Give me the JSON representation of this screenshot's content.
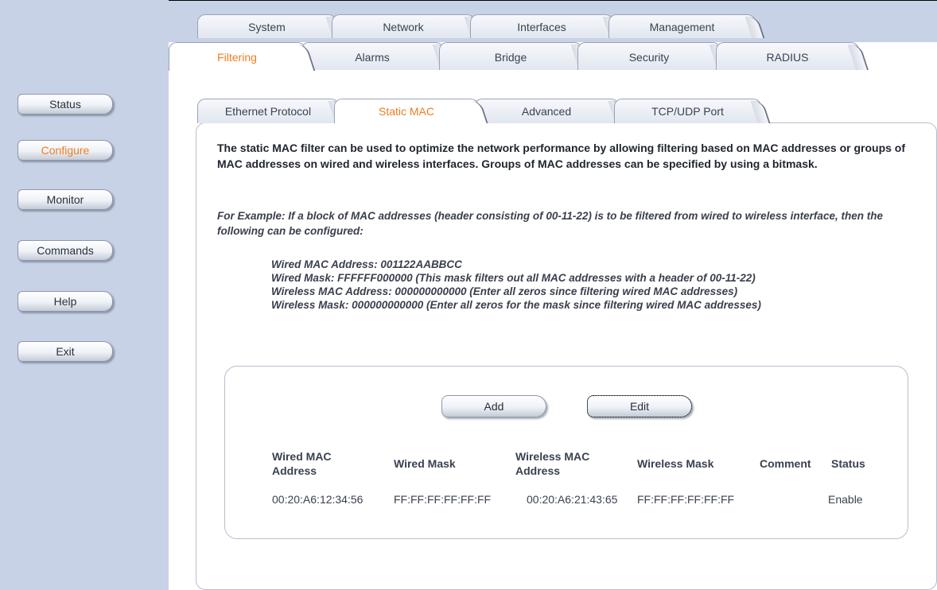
{
  "nav": {
    "items": [
      {
        "label": "Status",
        "active": false
      },
      {
        "label": "Configure",
        "active": true
      },
      {
        "label": "Monitor",
        "active": false
      },
      {
        "label": "Commands",
        "active": false
      },
      {
        "label": "Help",
        "active": false
      },
      {
        "label": "Exit",
        "active": false
      }
    ]
  },
  "tabs_row1": [
    "System",
    "Network",
    "Interfaces",
    "Management"
  ],
  "tabs_row2": [
    "Filtering",
    "Alarms",
    "Bridge",
    "Security",
    "RADIUS"
  ],
  "tabs_row3": [
    "Ethernet Protocol",
    "Static MAC",
    "Advanced",
    "TCP/UDP Port"
  ],
  "active": {
    "row2": "Filtering",
    "row3": "Static MAC"
  },
  "content": {
    "description": "The static MAC filter can be used to optimize the network performance by allowing filtering based on MAC addresses or groups of MAC addresses on wired and wireless interfaces. Groups of MAC addresses can be specified by using a bitmask.",
    "example_intro": "For Example: If a block of MAC addresses (header consisting of 00-11-22) is to be filtered from wired to wireless interface, then the following can be configured:",
    "example_lines": [
      "Wired MAC Address: 001122AABBCC",
      "Wired Mask: FFFFFF000000 (This mask filters out all MAC addresses with a header of 00-11-22)",
      "Wireless MAC Address: 000000000000 (Enter all zeros since filtering wired MAC addresses)",
      "Wireless Mask: 000000000000 (Enter all zeros for the mask since filtering wired MAC addresses)"
    ]
  },
  "buttons": {
    "add": "Add",
    "edit": "Edit"
  },
  "table": {
    "headers": {
      "wired_mac": "Wired MAC Address",
      "wired_mask": "Wired Mask",
      "wireless_mac": "Wireless MAC Address",
      "wireless_mask": "Wireless Mask",
      "comment": "Comment",
      "status": "Status"
    },
    "rows": [
      {
        "wired_mac": "00:20:A6:12:34:56",
        "wired_mask": "FF:FF:FF:FF:FF:FF",
        "wireless_mac": "00:20:A6:21:43:65",
        "wireless_mask": "FF:FF:FF:FF:FF:FF",
        "comment": "",
        "status": "Enable"
      }
    ]
  },
  "colors": {
    "accent": "#f07d20",
    "background": "#c8d2e6"
  }
}
